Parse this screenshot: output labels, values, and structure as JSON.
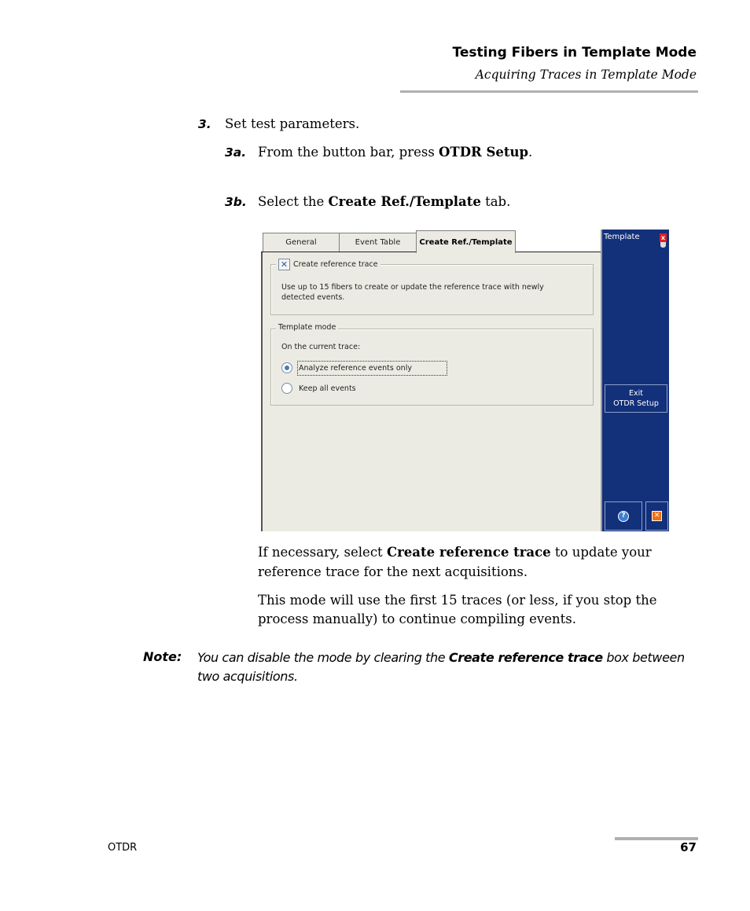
{
  "header": {
    "chapter_title": "Testing Fibers in Template Mode",
    "section_title": "Acquiring Traces in Template Mode"
  },
  "steps": {
    "step3": {
      "number": "3.",
      "text": "Set test parameters."
    },
    "step3a": {
      "number": "3a.",
      "text_before": "From the button bar, press ",
      "bold": "OTDR Setup",
      "text_after": "."
    },
    "step3b": {
      "number": "3b.",
      "text_before": "Select the ",
      "bold": "Create Ref./Template",
      "text_after": " tab."
    }
  },
  "screenshot": {
    "tabs": [
      {
        "label": "General",
        "active": false
      },
      {
        "label": "Event Table",
        "active": false
      },
      {
        "label": "Create Ref./Template",
        "active": true
      }
    ],
    "reference_group": {
      "checkbox_label": "Create reference trace",
      "checked": true,
      "description_line1": "Use up to 15 fibers to create or update the reference trace with newly",
      "description_line2": "detected events."
    },
    "template_group": {
      "legend": "Template mode",
      "prompt": "On the current trace:",
      "options": [
        {
          "label": "Analyze reference events only",
          "selected": true
        },
        {
          "label": "Keep all events",
          "selected": false
        }
      ]
    },
    "side_panel": {
      "title": "Template",
      "battery_icon": "battery-icon",
      "exit_button_line1": "Exit",
      "exit_button_line2": "OTDR Setup",
      "help_icon": "?",
      "close_icon": "✕",
      "panel_color": "#13307a"
    }
  },
  "paragraphs": {
    "p1_before": "If necessary, select ",
    "p1_bold": "Create reference trace",
    "p1_after_line1": " to update your",
    "p1_line2": "reference trace for the next acquisitions.",
    "p2_line1": "This mode will use the first 15 traces (or less, if you stop the",
    "p2_line2": "process manually) to continue compiling events."
  },
  "note": {
    "label": "Note:",
    "text_before": "You can disable the mode by clearing the ",
    "bold": "Create reference trace",
    "text_after": " box between two acquisitions."
  },
  "footer": {
    "product": "OTDR",
    "page_number": "67"
  }
}
